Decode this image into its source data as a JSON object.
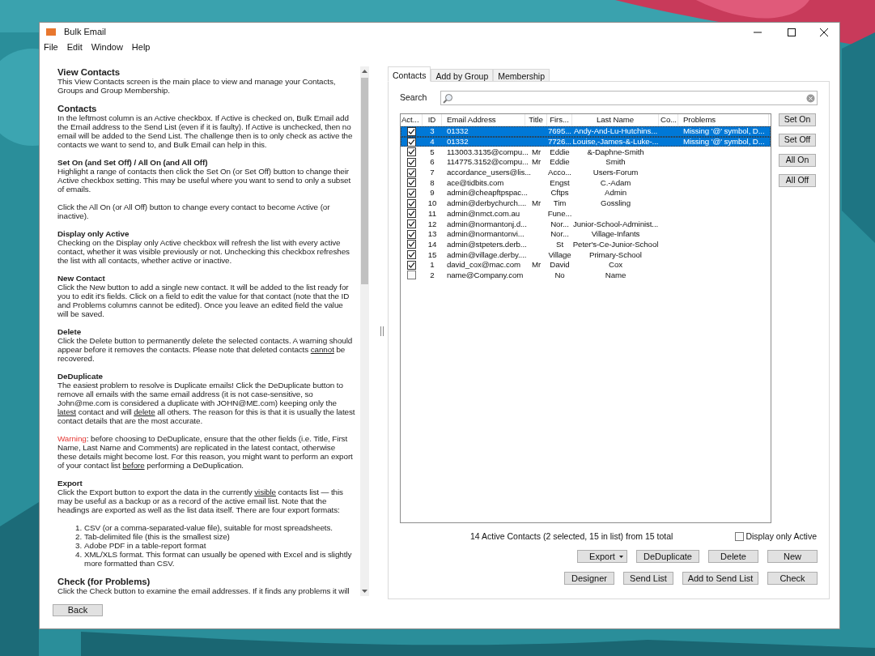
{
  "window": {
    "title": "Bulk Email"
  },
  "menu": [
    "File",
    "Edit",
    "Window",
    "Help"
  ],
  "help": [
    {
      "kind": "h1",
      "text": "View Contacts"
    },
    {
      "kind": "p",
      "segments": [
        {
          "text": "This View Contacts screen is the main place to view and manage your Contacts, Groups and Group Membership.",
          "kind": "plain"
        }
      ]
    },
    {
      "kind": "h1",
      "text": "Contacts"
    },
    {
      "kind": "p",
      "segments": [
        {
          "text": "In the leftmost column is an Active checkbox. If Active is checked on, Bulk Email add the Email address to the Send List (even if it is faulty). If Active is unchecked, then no email will be added to the Send List. The challenge then is to only check as active the contacts we want to send to, and Bulk Email can help in this.",
          "kind": "plain"
        }
      ]
    },
    {
      "kind": "h2",
      "text": "Set On (and Set Off) / All On (and All Off)"
    },
    {
      "kind": "p",
      "segments": [
        {
          "text": "Highlight a range of contacts then click the Set On (or Set Off) button to change their Active checkbox setting. This may be useful where you want to send to only a subset of emails.",
          "kind": "plain"
        }
      ]
    },
    {
      "kind": "p",
      "segments": [
        {
          "text": "Click the All On (or All Off) button to change every contact to become Active (or inactive).",
          "kind": "plain"
        }
      ]
    },
    {
      "kind": "h2",
      "text": "Display only Active"
    },
    {
      "kind": "p",
      "segments": [
        {
          "text": "Checking on the Display only Active checkbox will refresh the list with every active contact, whether it was visible previously or not. Unchecking this checkbox refreshes the list with all contacts, whether active or inactive.",
          "kind": "plain"
        }
      ]
    },
    {
      "kind": "h2",
      "text": "New Contact"
    },
    {
      "kind": "p",
      "segments": [
        {
          "text": "Click the New button to add a single new contact. It will be added to the list ready for you to edit it's fields. Click on a field to edit the value for that contact (note that the ID and Problems columns cannot be edited). Once you leave an edited field the value will be saved.",
          "kind": "plain"
        }
      ]
    },
    {
      "kind": "h2",
      "text": "Delete"
    },
    {
      "kind": "p",
      "segments": [
        {
          "text": "Click the Delete button to permanently delete the selected contacts. A warning should appear before it removes the contacts. Please note that deleted contacts ",
          "kind": "plain"
        },
        {
          "text": "cannot",
          "kind": "underline"
        },
        {
          "text": " be recovered.",
          "kind": "plain"
        }
      ]
    },
    {
      "kind": "h2",
      "text": "DeDuplicate"
    },
    {
      "kind": "p",
      "segments": [
        {
          "text": "The easiest problem to resolve is Duplicate emails! Click the DeDuplicate button to remove all emails with the same email address (it is not case-sensitive, so John@me.com is considered a duplicate with JOHN@ME.com) keeping only the ",
          "kind": "plain"
        },
        {
          "text": "latest",
          "kind": "underline"
        },
        {
          "text": " contact and will ",
          "kind": "plain"
        },
        {
          "text": "delete",
          "kind": "underline"
        },
        {
          "text": " all others. The reason for this is that it is usually the latest contact details that are the most accurate.",
          "kind": "plain"
        }
      ]
    },
    {
      "kind": "p",
      "segments": [
        {
          "text": "Warning",
          "kind": "warning"
        },
        {
          "text": ": before choosing to DeDuplicate, ensure that the other fields (i.e. Title, First Name, Last Name and Comments) are replicated in the latest contact, otherwise these details might become lost. For this reason, you might want to perform an export of your contact list ",
          "kind": "plain"
        },
        {
          "text": "before",
          "kind": "underline"
        },
        {
          "text": " performing a DeDuplication.",
          "kind": "plain"
        }
      ]
    },
    {
      "kind": "h2",
      "text": "Export"
    },
    {
      "kind": "p",
      "segments": [
        {
          "text": "Click the Export button to export the data in the currently ",
          "kind": "plain"
        },
        {
          "text": "visible",
          "kind": "underline"
        },
        {
          "text": " contacts list — this may be useful as a backup or as a record of the active email list. Note that the headings are exported as well as the list data itself. There are four export formats:",
          "kind": "plain"
        }
      ]
    },
    {
      "kind": "list",
      "items": [
        {
          "number": "1.",
          "text": "CSV (or a comma-separated-value file), suitable for most spreadsheets."
        },
        {
          "number": "2.",
          "text": "Tab-delimited file (this is the smallest size)"
        },
        {
          "number": "3.",
          "text": "Adobe PDF in a table-report format"
        },
        {
          "number": "4.",
          "text": "XML/XLS format. This format can usually be opened with Excel and is slightly more formatted than CSV."
        }
      ]
    },
    {
      "kind": "h1",
      "text": "Check (for Problems)"
    },
    {
      "kind": "p",
      "segments": [
        {
          "text": "Click the Check button to examine the email addresses. If it finds any problems it will",
          "kind": "plain"
        }
      ]
    }
  ],
  "back_button": "Back",
  "tabs": [
    {
      "label": "Contacts",
      "selected": true
    },
    {
      "label": "Add by Group",
      "selected": false
    },
    {
      "label": "Membership",
      "selected": false
    }
  ],
  "search": {
    "label": "Search"
  },
  "table": {
    "active_column": "Act...",
    "columns": [
      "ID",
      "Email Address",
      "Title",
      "Firs...",
      "Last Name",
      "Co...",
      "Problems"
    ],
    "rows": [
      {
        "active": true,
        "selected": true,
        "cells": [
          "3",
          "01332",
          "",
          "7695...",
          "Andy-And-Lu-Hutchins...",
          "",
          "Missing '@' symbol, D..."
        ]
      },
      {
        "active": true,
        "selected": true,
        "cells": [
          "4",
          "01332",
          "",
          "7726...",
          "Louise,-James-&-Luke-...",
          "",
          "Missing '@' symbol, D..."
        ]
      },
      {
        "active": true,
        "selected": false,
        "cells": [
          "5",
          "113003.3135@compu...",
          "Mr",
          "Eddie",
          "&-Daphne-Smith",
          "",
          ""
        ]
      },
      {
        "active": true,
        "selected": false,
        "cells": [
          "6",
          "114775.3152@compu...",
          "Mr",
          "Eddie",
          "Smith",
          "",
          ""
        ]
      },
      {
        "active": true,
        "selected": false,
        "cells": [
          "7",
          "accordance_users@lis...",
          "",
          "Acco...",
          "Users-Forum",
          "",
          ""
        ]
      },
      {
        "active": true,
        "selected": false,
        "cells": [
          "8",
          "ace@tidbits.com",
          "",
          "Engst",
          "C.-Adam",
          "",
          ""
        ]
      },
      {
        "active": true,
        "selected": false,
        "cells": [
          "9",
          "admin@cheapftpspac...",
          "",
          "Cftps",
          "Admin",
          "",
          ""
        ]
      },
      {
        "active": true,
        "selected": false,
        "cells": [
          "10",
          "admin@derbychurch....",
          "Mr",
          "Tim",
          "Gossling",
          "",
          ""
        ]
      },
      {
        "active": true,
        "selected": false,
        "cells": [
          "11",
          "admin@nmct.com.au",
          "",
          "Fune...",
          "",
          "",
          ""
        ]
      },
      {
        "active": true,
        "selected": false,
        "cells": [
          "12",
          "admin@normantonj.d...",
          "",
          "Nor...",
          "Junior-School-Administ...",
          "",
          ""
        ]
      },
      {
        "active": true,
        "selected": false,
        "cells": [
          "13",
          "admin@normantonvi...",
          "",
          "Nor...",
          "Village-Infants",
          "",
          ""
        ]
      },
      {
        "active": true,
        "selected": false,
        "cells": [
          "14",
          "admin@stpeters.derb...",
          "",
          "St",
          "Peter's-Ce-Junior-School",
          "",
          ""
        ]
      },
      {
        "active": true,
        "selected": false,
        "cells": [
          "15",
          "admin@village.derby....",
          "",
          "Village",
          "Primary-School",
          "",
          ""
        ]
      },
      {
        "active": true,
        "selected": false,
        "cells": [
          "1",
          "david_cox@mac.com",
          "Mr",
          "David",
          "Cox",
          "",
          ""
        ]
      },
      {
        "active": false,
        "selected": false,
        "cells": [
          "2",
          "name@Company.com",
          "",
          "No",
          "Name",
          "",
          ""
        ]
      }
    ]
  },
  "side_buttons": [
    "Set On",
    "Set Off",
    "All On",
    "All Off"
  ],
  "status": "14 Active Contacts (2 selected, 15 in list) from 15 total",
  "display_only_active": {
    "label": "Display only Active",
    "checked": false
  },
  "button_rows": [
    [
      {
        "label": "Export",
        "dropdown": true
      },
      {
        "label": "DeDuplicate",
        "dropdown": false
      },
      {
        "label": "Delete",
        "dropdown": false
      },
      {
        "label": "New",
        "dropdown": false
      }
    ],
    [
      {
        "label": "Designer",
        "dropdown": false
      },
      {
        "label": "Send List",
        "dropdown": false
      },
      {
        "label": "Add to Send List",
        "dropdown": false
      },
      {
        "label": "Check",
        "dropdown": false
      }
    ]
  ]
}
